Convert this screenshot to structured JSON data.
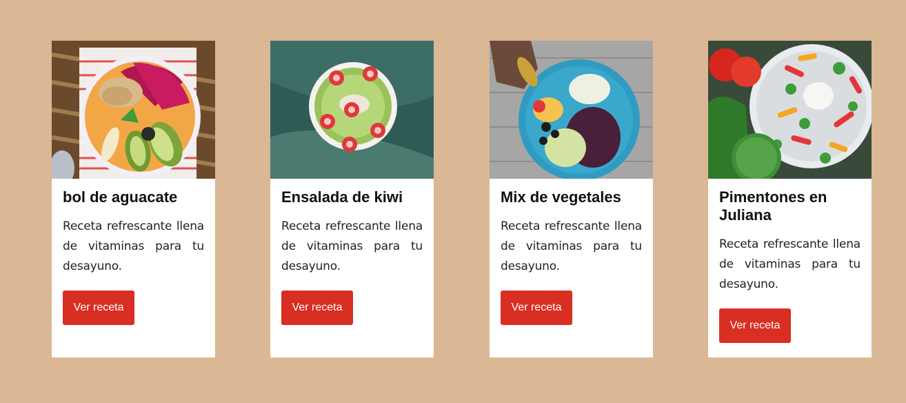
{
  "colors": {
    "background": "#dab795",
    "card": "#ffffff",
    "button": "#d92e22",
    "button_text": "#ffffff"
  },
  "cards": [
    {
      "title": "bol de aguacate",
      "description": "Receta refrescante llena de vitaminas para tu desayuno.",
      "button_label": "Ver receta",
      "image": "avocado-bowl-photo"
    },
    {
      "title": "Ensalada de kiwi",
      "description": "Receta refrescante llena de vitaminas para tu desayuno.",
      "button_label": "Ver receta",
      "image": "kiwi-salad-photo"
    },
    {
      "title": "Mix de vegetales",
      "description": "Receta refrescante llena de vitaminas para tu desayuno.",
      "button_label": "Ver receta",
      "image": "vegetable-mix-photo"
    },
    {
      "title": "Pimentones en Juliana",
      "description": "Receta refrescante llena de vitaminas para tu desayuno.",
      "button_label": "Ver receta",
      "image": "julienne-peppers-photo"
    }
  ]
}
